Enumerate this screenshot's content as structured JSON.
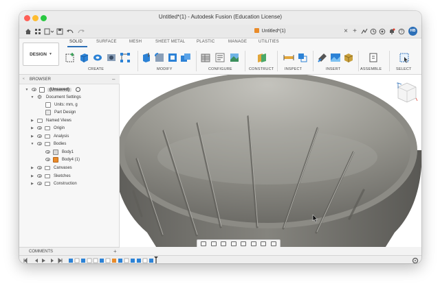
{
  "window": {
    "title": "Untitled*(1) - Autodesk Fusion (Education License)"
  },
  "app_bar": {
    "doc_tab_title": "Untitled*(1)",
    "close_glyph": "×",
    "plus_glyph": "+",
    "avatar_initials": "HB"
  },
  "ribbon": {
    "workspace_label": "DESIGN",
    "tabs": [
      "SOLID",
      "SURFACE",
      "MESH",
      "SHEET METAL",
      "PLASTIC",
      "MANAGE",
      "UTILITIES"
    ],
    "active_tab": "SOLID",
    "groups": [
      "CREATE",
      "MODIFY",
      "CONFIGURE",
      "CONSTRUCT",
      "INSPECT",
      "INSERT",
      "ASSEMBLE",
      "SELECT"
    ],
    "accent_color": "#2c6fb7"
  },
  "browser": {
    "header": "BROWSER",
    "collapse_glyph": "–",
    "root_label": "(Unsaved)",
    "items": [
      {
        "label": "Document Settings"
      },
      {
        "label": "Units: mm, g"
      },
      {
        "label": "Part Design"
      },
      {
        "label": "Named Views"
      },
      {
        "label": "Origin"
      },
      {
        "label": "Analysis"
      },
      {
        "label": "Bodies"
      },
      {
        "label": "Body1"
      },
      {
        "label": "Body4 (1)"
      },
      {
        "label": "Canvases"
      },
      {
        "label": "Sketches"
      },
      {
        "label": "Construction"
      }
    ]
  },
  "comments": {
    "label": "COMMENTS",
    "add_glyph": "+"
  },
  "colors": {
    "traffic_close": "#ff5f57",
    "traffic_min": "#febc2e",
    "traffic_max": "#28c840",
    "body_orange": "#e98b2a",
    "bowl_gray": "#7c7b76"
  }
}
